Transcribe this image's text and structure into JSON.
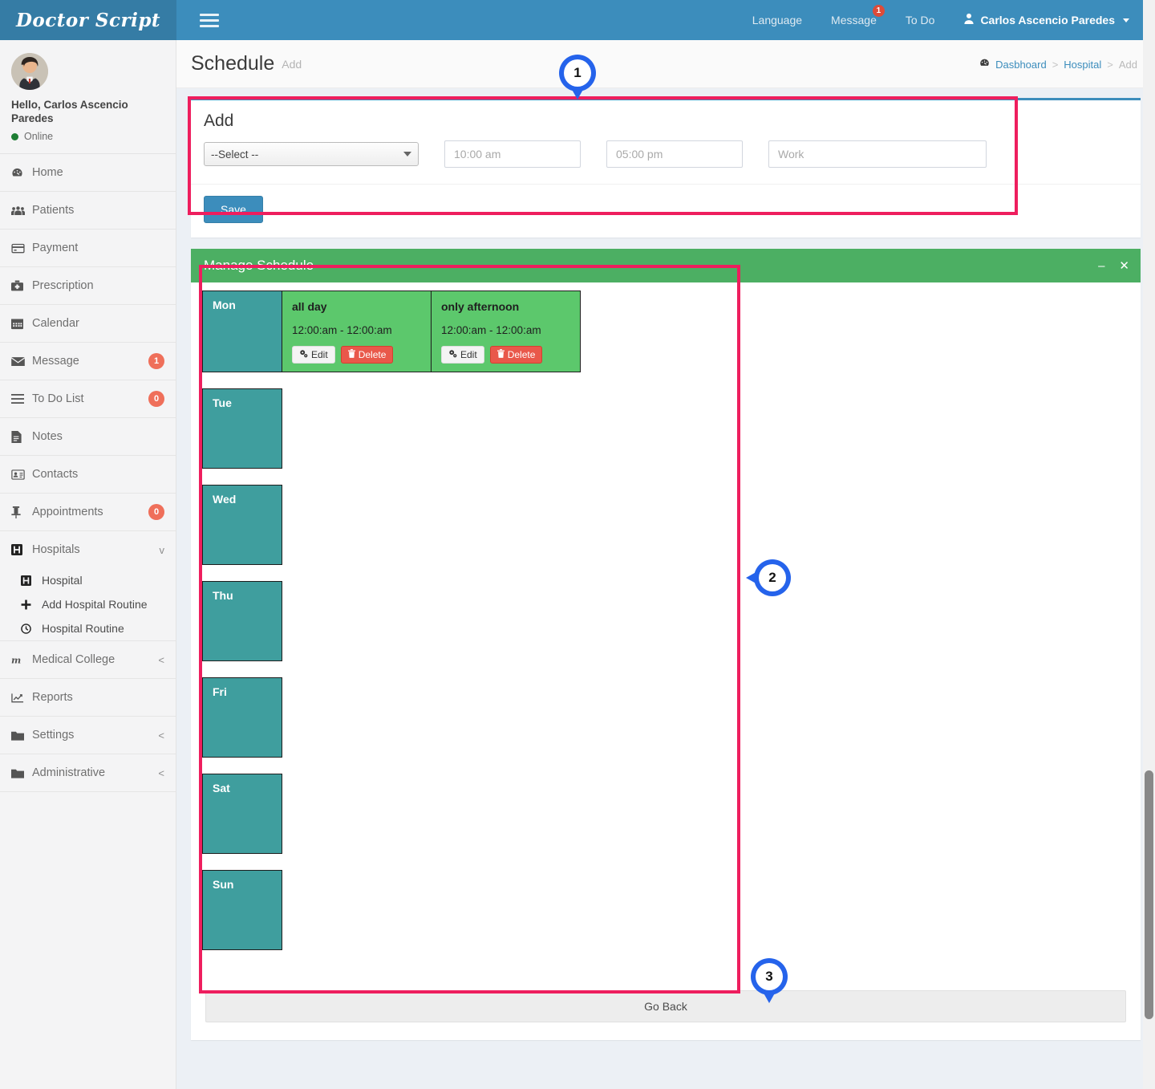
{
  "brand": {
    "name": "Doctor Script"
  },
  "topnav": {
    "menu_icon": "hamburger-icon",
    "items": [
      {
        "label": "Language",
        "badge": null
      },
      {
        "label": "Message",
        "badge": "1"
      },
      {
        "label": "To Do",
        "badge": null
      }
    ],
    "user": {
      "label": "Carlos Ascencio Paredes",
      "icon": "user-icon"
    }
  },
  "sidebar": {
    "user": {
      "greeting": "Hello, Carlos Ascencio Paredes",
      "status": "Online",
      "avatar": "avatar"
    },
    "items": [
      {
        "label": "Home",
        "icon": "dashboard-icon",
        "badge": null,
        "chevron": null
      },
      {
        "label": "Patients",
        "icon": "users-icon",
        "badge": null,
        "chevron": null
      },
      {
        "label": "Payment",
        "icon": "credit-card-icon",
        "badge": null,
        "chevron": null
      },
      {
        "label": "Prescription",
        "icon": "medkit-icon",
        "badge": null,
        "chevron": null
      },
      {
        "label": "Calendar",
        "icon": "calendar-icon",
        "badge": null,
        "chevron": null
      },
      {
        "label": "Message",
        "icon": "envelope-icon",
        "badge": "1",
        "chevron": null
      },
      {
        "label": "To Do List",
        "icon": "list-icon",
        "badge": "0",
        "chevron": null
      },
      {
        "label": "Notes",
        "icon": "file-text-icon",
        "badge": null,
        "chevron": null
      },
      {
        "label": "Contacts",
        "icon": "address-card-icon",
        "badge": null,
        "chevron": null
      },
      {
        "label": "Appointments",
        "icon": "thumbtack-icon",
        "badge": "0",
        "chevron": null
      },
      {
        "label": "Hospitals",
        "icon": "hospital-icon",
        "badge": null,
        "chevron": "v"
      }
    ],
    "hospitals_submenu": [
      {
        "label": "Hospital",
        "icon": "hospital-icon"
      },
      {
        "label": "Add Hospital Routine",
        "icon": "plus-icon"
      },
      {
        "label": "Hospital Routine",
        "icon": "clock-icon"
      }
    ],
    "items_after": [
      {
        "label": "Medical College",
        "icon": "m-letter-icon",
        "badge": null,
        "chevron": "<"
      },
      {
        "label": "Reports",
        "icon": "chart-line-icon",
        "badge": null,
        "chevron": null
      },
      {
        "label": "Settings",
        "icon": "folder-icon",
        "badge": null,
        "chevron": "<"
      },
      {
        "label": "Administrative",
        "icon": "folder-icon",
        "badge": null,
        "chevron": "<"
      }
    ]
  },
  "page": {
    "title": "Schedule",
    "subtitle": "Add",
    "breadcrumb": [
      {
        "label": "Dasbhoard",
        "icon": "dashboard-icon",
        "current": false
      },
      {
        "label": "Hospital",
        "icon": null,
        "current": false
      },
      {
        "label": "Add",
        "icon": null,
        "current": true
      }
    ]
  },
  "add_form": {
    "heading": "Add",
    "day_select": {
      "value": "--Select --",
      "icon": "chevron-down-icon"
    },
    "start_time": {
      "placeholder": "10:00 am",
      "value": ""
    },
    "end_time": {
      "placeholder": "05:00 pm",
      "value": ""
    },
    "note": {
      "placeholder": "Work",
      "value": ""
    },
    "save_label": "Save"
  },
  "manage_panel": {
    "title": "Manage Schedule",
    "minimize_icon": "minus-icon",
    "close_icon": "close-icon"
  },
  "schedule": {
    "edit_label": "Edit",
    "delete_label": "Delete",
    "edit_icon": "gears-icon",
    "delete_icon": "trash-icon",
    "days": [
      {
        "day": "Mon",
        "slots": [
          {
            "name": "all day",
            "time": "12:00:am - 12:00:am"
          },
          {
            "name": "only afternoon",
            "time": "12:00:am - 12:00:am"
          }
        ]
      },
      {
        "day": "Tue",
        "slots": []
      },
      {
        "day": "Wed",
        "slots": []
      },
      {
        "day": "Thu",
        "slots": []
      },
      {
        "day": "Fri",
        "slots": []
      },
      {
        "day": "Sat",
        "slots": []
      },
      {
        "day": "Sun",
        "slots": []
      }
    ]
  },
  "footer": {
    "go_back_label": "Go Back"
  },
  "annotations": {
    "markers": [
      {
        "number": "1",
        "direction": "down"
      },
      {
        "number": "2",
        "direction": "left"
      },
      {
        "number": "3",
        "direction": "down"
      }
    ],
    "highlight_color": "#ee1e5e",
    "marker_color": "#2563eb"
  },
  "colors": {
    "topbar_blue": "#3c8dbc",
    "panel_green": "#4caf63",
    "slot_green": "#5cc86c",
    "day_teal": "#3f9e9e",
    "badge_red": "#ef6f5a",
    "delete_red": "#e9584a"
  }
}
